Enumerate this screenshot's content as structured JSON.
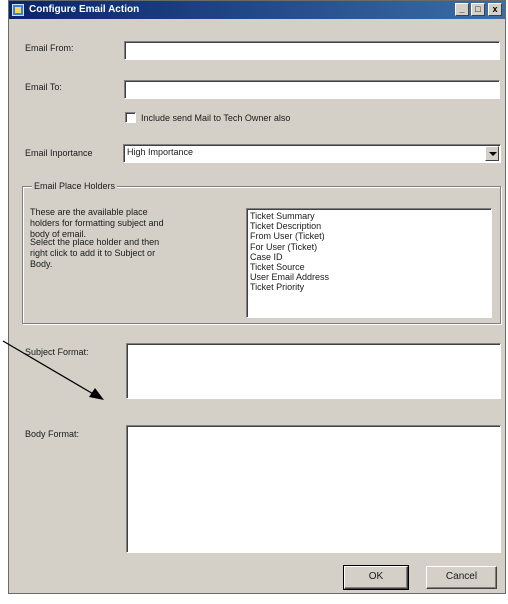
{
  "window": {
    "title": "Configure Email Action",
    "controls": {
      "minimize": "_",
      "maximize": "□",
      "close": "x"
    }
  },
  "form": {
    "email_from": {
      "label": "Email From:",
      "value": ""
    },
    "email_to": {
      "label": "Email To:",
      "value": ""
    },
    "include_tech_owner": {
      "label": "Include send Mail to Tech Owner also",
      "checked": false
    },
    "email_importance": {
      "label": "Email Inportance",
      "selected": "High Importance"
    }
  },
  "placeholders": {
    "group_title": "Email Place Holders",
    "help_line1": "These are the available place holders for formatting subject and body of email.",
    "help_line2": "Select the place holder and then right click to add it to Subject or Body.",
    "items": [
      "Ticket Summary",
      "Ticket Description",
      "From User (Ticket)",
      "For User (Ticket)",
      "Case ID",
      "Ticket Source",
      "User Email Address",
      "Ticket Priority"
    ]
  },
  "subject": {
    "label": "Subject Format:",
    "value": ""
  },
  "body": {
    "label": "Body Format:",
    "value": ""
  },
  "buttons": {
    "ok": "OK",
    "cancel": "Cancel"
  },
  "icons": [
    "app-icon",
    "dropdown-arrow-icon",
    "annotation-arrow-icon"
  ]
}
